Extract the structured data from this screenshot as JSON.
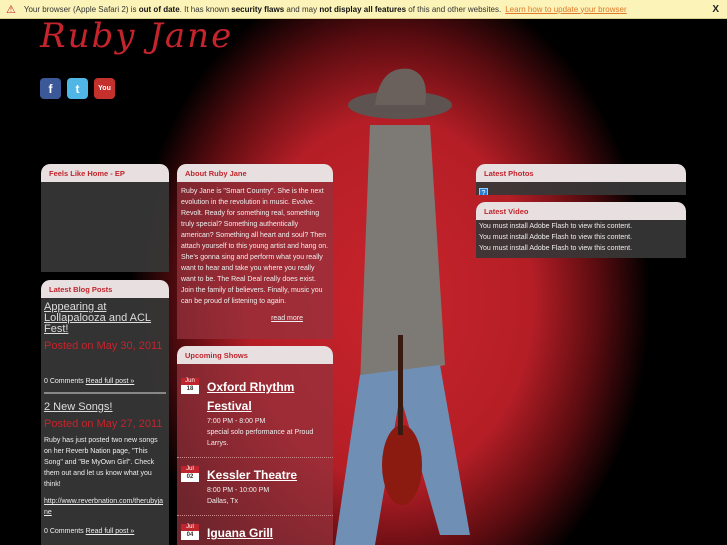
{
  "notice": {
    "pre": "Your browser (Apple Safari 2) is",
    "b1": "out of date",
    "mid1": ". It has known",
    "b2": "security flaws",
    "mid2": "and may",
    "b3": "not display all features",
    "post": "of this and other websites.",
    "link": "Learn how to update your browser",
    "close": "X"
  },
  "logo": "Ruby Jane",
  "social": [
    {
      "icon": "facebook-icon",
      "glyph": "f",
      "color": "#3b5998"
    },
    {
      "icon": "twitter-icon",
      "glyph": "t",
      "color": "#4fb6e6"
    },
    {
      "icon": "youtube-icon",
      "glyph": "You",
      "color": "#c4302b"
    }
  ],
  "ep": {
    "title": "Feels Like Home - EP"
  },
  "about": {
    "title": "About Ruby Jane",
    "text": "Ruby Jane is \"Smart Country\". She is the next evolution in the revolution in music. Evolve. Revolt. Ready for something real, something truly special? Something authentically american? Something all heart and soul? Then attach yourself to this young artist and hang on. She's gonna sing and perform what you really want to hear and take you where you really want to be. The Real Deal really does exist. Join the family of believers. Finally, music you can be proud of listening to again.",
    "more": "read more"
  },
  "blog": {
    "title": "Latest Blog Posts",
    "posts": [
      {
        "title": "Appearing at Lollapalooza and ACL Fest!",
        "posted": "Posted on May 30, 2011",
        "body": "",
        "comments": "0 Comments",
        "read": "Read full post »"
      },
      {
        "title": "2 New Songs!",
        "posted": "Posted on May 27, 2011",
        "body": "Ruby has just posted two new songs on her Reverb Nation page, \"This Song\" and \"Be MyOwn Girl\". Check them out and let us know what you think!",
        "link": "http://www.reverbnation.com/therubyjane",
        "comments": "0 Comments",
        "read": "Read full post »"
      }
    ]
  },
  "shows": {
    "title": "Upcoming Shows",
    "items": [
      {
        "month": "Jun",
        "day": "18",
        "name": "Oxford Rhythm Festival",
        "time": "7:00 PM - 8:00 PM",
        "info": "special solo performance at Proud Larrys."
      },
      {
        "month": "Jul",
        "day": "02",
        "name": "Kessler Theatre",
        "time": "8:00 PM - 10:00 PM",
        "info": "Dallas, Tx"
      },
      {
        "month": "Jul",
        "day": "04",
        "name": "Iguana Grill",
        "time": "",
        "info": ""
      }
    ]
  },
  "photos": {
    "title": "Latest Photos",
    "placeholder": "?"
  },
  "video": {
    "title": "Latest Video",
    "lines": [
      "You must install Adobe Flash to view this content.",
      "You must install Adobe Flash to view this content.",
      "You must install Adobe Flash to view this content."
    ]
  }
}
